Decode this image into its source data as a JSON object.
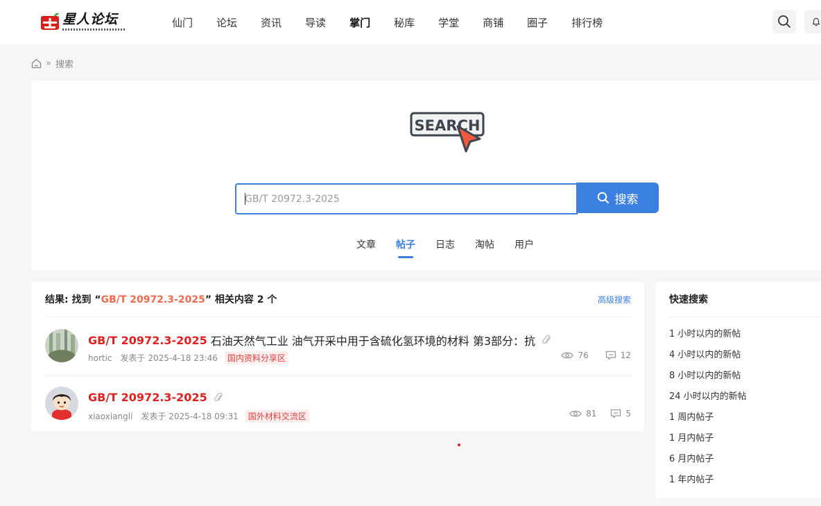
{
  "header": {
    "logo_title": "星人论坛",
    "nav": [
      "仙门",
      "论坛",
      "资讯",
      "导读",
      "掌门",
      "秘库",
      "学堂",
      "商铺",
      "圈子",
      "排行榜"
    ],
    "nav_active": "掌门"
  },
  "breadcrumb": {
    "sep": "»",
    "current": "搜索"
  },
  "search": {
    "logo_text": "SEARCH",
    "query": "GB/T 20972.3-2025",
    "button_label": "搜索",
    "tabs": [
      "文章",
      "帖子",
      "日志",
      "淘帖",
      "用户"
    ],
    "active_tab": "帖子"
  },
  "results": {
    "summary_prefix": "结果: 找到 “",
    "keyword": "GB/T 20972.3-2025",
    "summary_suffix": "” 相关内容 2 个",
    "advanced_label": "高级搜索",
    "items": [
      {
        "title_hl": "GB/T 20972.3-2025",
        "title_rest": "石油天然气工业 油气开采中用于含硫化氢环境的材料 第3部分：抗",
        "author": "hortic",
        "time": "发表于 2025-4-18 23:46",
        "forum": "国内资料分享区",
        "views": "76",
        "replies": "12"
      },
      {
        "title_hl": "GB/T 20972.3-2025",
        "title_rest": "",
        "author": "xiaoxiangli",
        "time": "发表于 2025-4-18 09:31",
        "forum": "国外材料交流区",
        "views": "81",
        "replies": "5"
      }
    ]
  },
  "quick_search": {
    "title": "快速搜索",
    "items": [
      "1 小时以内的新帖",
      "4 小时以内的新帖",
      "8 小时以内的新帖",
      "24 小时以内的新帖",
      "1 周内帖子",
      "1 月内帖子",
      "6 月内帖子",
      "1 年内帖子"
    ]
  },
  "colors": {
    "primary": "#3b7fe0",
    "highlight": "#e02020",
    "keyword": "#f06a4b"
  }
}
